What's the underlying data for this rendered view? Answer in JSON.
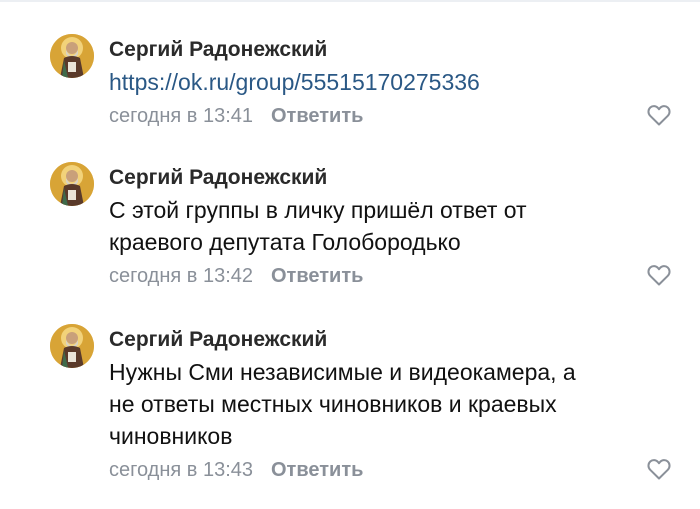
{
  "comments": [
    {
      "author": "Сергий Радонежский",
      "text": "https://ok.ru/group/55515170275336",
      "is_link": true,
      "time": "сегодня в 13:41",
      "reply_label": "Ответить"
    },
    {
      "author": "Сергий Радонежский",
      "text": "С этой группы в личку пришёл ответ от\nкраевого депутата Голобородько",
      "is_link": false,
      "time": "сегодня в 13:42",
      "reply_label": "Ответить"
    },
    {
      "author": "Сергий Радонежский",
      "text": "Нужны Сми независимые и видеокамера, а\nне ответы местных чиновников и краевых\nчиновников",
      "is_link": false,
      "time": "сегодня в 13:43",
      "reply_label": "Ответить"
    }
  ],
  "icons": {
    "avatar": "icon-saint-avatar",
    "like": "heart-outline-icon"
  },
  "colors": {
    "link": "#2a5885",
    "meta": "#8a9099",
    "avatar_background": "#d8a436"
  }
}
